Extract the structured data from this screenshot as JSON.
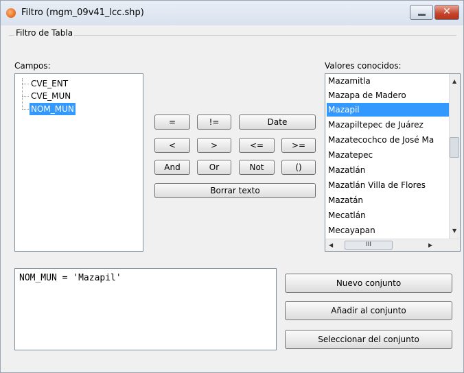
{
  "window": {
    "title": "Filtro (mgm_09v41_lcc.shp)"
  },
  "group": {
    "label": "Filtro de Tabla"
  },
  "fields": {
    "label": "Campos:",
    "items": [
      "CVE_ENT",
      "CVE_MUN",
      "NOM_MUN"
    ],
    "selected": "NOM_MUN"
  },
  "operators": {
    "eq": "=",
    "neq": "!=",
    "date": "Date",
    "lt": "<",
    "gt": ">",
    "lte": "<=",
    "gte": ">=",
    "and": "And",
    "or": "Or",
    "not": "Not",
    "parens": "()",
    "clear": "Borrar texto"
  },
  "values": {
    "label": "Valores conocidos:",
    "items": [
      "Mazamitla",
      "Mazapa de Madero",
      "Mazapil",
      "Mazapiltepec de Juárez",
      "Mazatecochco de José Ma",
      "Mazatepec",
      "Mazatlán",
      "Mazatlán Villa de Flores",
      "Mazatán",
      "Mecatlán",
      "Mecayapan"
    ],
    "selected": "Mazapil",
    "hscroll_thumb": "III"
  },
  "query": {
    "text": "NOM_MUN = 'Mazapil'"
  },
  "actions": {
    "new_set": "Nuevo conjunto",
    "add_to_set": "Añadir al conjunto",
    "select_from_set": "Seleccionar del conjunto"
  },
  "colors": {
    "selection": "#3399ff",
    "close_button": "#c4432a"
  }
}
